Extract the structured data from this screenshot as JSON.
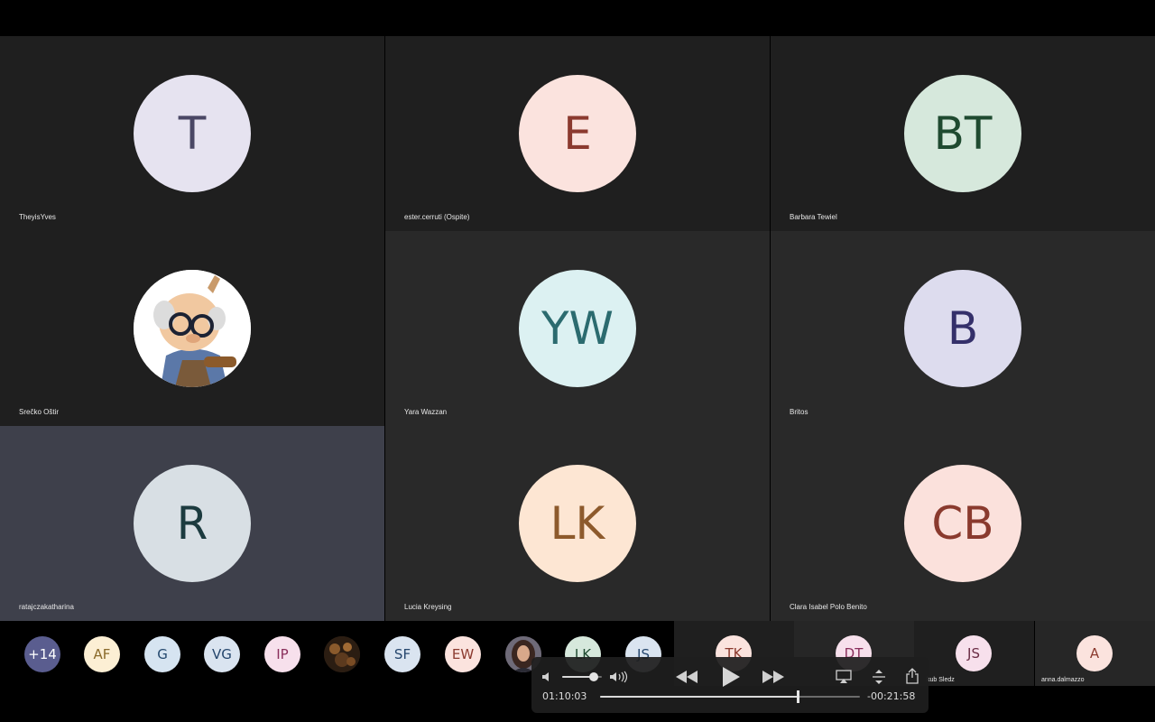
{
  "tiles": [
    {
      "name": "TheyisYves",
      "initials": "T",
      "bg": "#e6e3f0",
      "fg": "#4a4765"
    },
    {
      "name": "ester.cerruti (Ospite)",
      "initials": "E",
      "bg": "#fbe3de",
      "fg": "#8b3a2f"
    },
    {
      "name": "Barbara Tewiel",
      "initials": "BT",
      "bg": "#d6e8dc",
      "fg": "#1f4a30"
    },
    {
      "name": "Srečko Oštir",
      "initials": "",
      "bg": "#ffffff",
      "fg": "#000000",
      "avatar_icon": "cartoon-professor-avatar"
    },
    {
      "name": "Yara Wazzan",
      "initials": "YW",
      "bg": "#dcf1f2",
      "fg": "#2b6b6f"
    },
    {
      "name": "Britos",
      "initials": "B",
      "bg": "#dddcee",
      "fg": "#34306a"
    },
    {
      "name": "ratajczakatharina",
      "initials": "R",
      "bg": "#d8dfe4",
      "fg": "#1c3b3f"
    },
    {
      "name": "Lucia Kreysing",
      "initials": "LK",
      "bg": "#fde6d3",
      "fg": "#8d5a2c"
    },
    {
      "name": "Clara Isabel Polo Benito",
      "initials": "CB",
      "bg": "#fbe1dc",
      "fg": "#8a3a2e"
    }
  ],
  "strip": [
    {
      "initials": "+14",
      "bg": "#5a5d8f",
      "fg": "#ffffff"
    },
    {
      "initials": "AF",
      "bg": "#fcefd4",
      "fg": "#8a6a2a"
    },
    {
      "initials": "G",
      "bg": "#d6e4f1",
      "fg": "#25496f"
    },
    {
      "initials": "VG",
      "bg": "#dae4f0",
      "fg": "#25466d"
    },
    {
      "initials": "IP",
      "bg": "#f7e0ec",
      "fg": "#8a2f5c"
    },
    {
      "initials": "",
      "bg": "#3a2a1c",
      "fg": "#ffffff",
      "avatar_icon": "photo-avatar-dark"
    },
    {
      "initials": "SF",
      "bg": "#dae4f0",
      "fg": "#25466d"
    },
    {
      "initials": "EW",
      "bg": "#fbe3de",
      "fg": "#8b3a2f"
    },
    {
      "initials": "",
      "bg": "#5a4c55",
      "fg": "#ffffff",
      "avatar_icon": "photo-avatar-woman"
    },
    {
      "initials": "LK",
      "bg": "#d6e8dc",
      "fg": "#1f4a30"
    },
    {
      "initials": "JS",
      "bg": "#dae4f0",
      "fg": "#25466d"
    }
  ],
  "side_tiles": [
    {
      "initials": "TK",
      "name": "",
      "bg": "#fbe3de",
      "fg": "#8b3a2f"
    },
    {
      "initials": "DT",
      "name": "",
      "bg": "#f7e0ec",
      "fg": "#8a2f5c"
    },
    {
      "initials": "JS",
      "name": "kub Sledz",
      "bg": "#f7e0ec",
      "fg": "#6a2c44"
    },
    {
      "initials": "A",
      "name": "anna.dalmazzo",
      "bg": "#fbe3de",
      "fg": "#8b3a2f"
    }
  ],
  "player": {
    "elapsed": "01:10:03",
    "remaining": "-00:21:58",
    "progress": 0.76,
    "volume": 0.8
  }
}
